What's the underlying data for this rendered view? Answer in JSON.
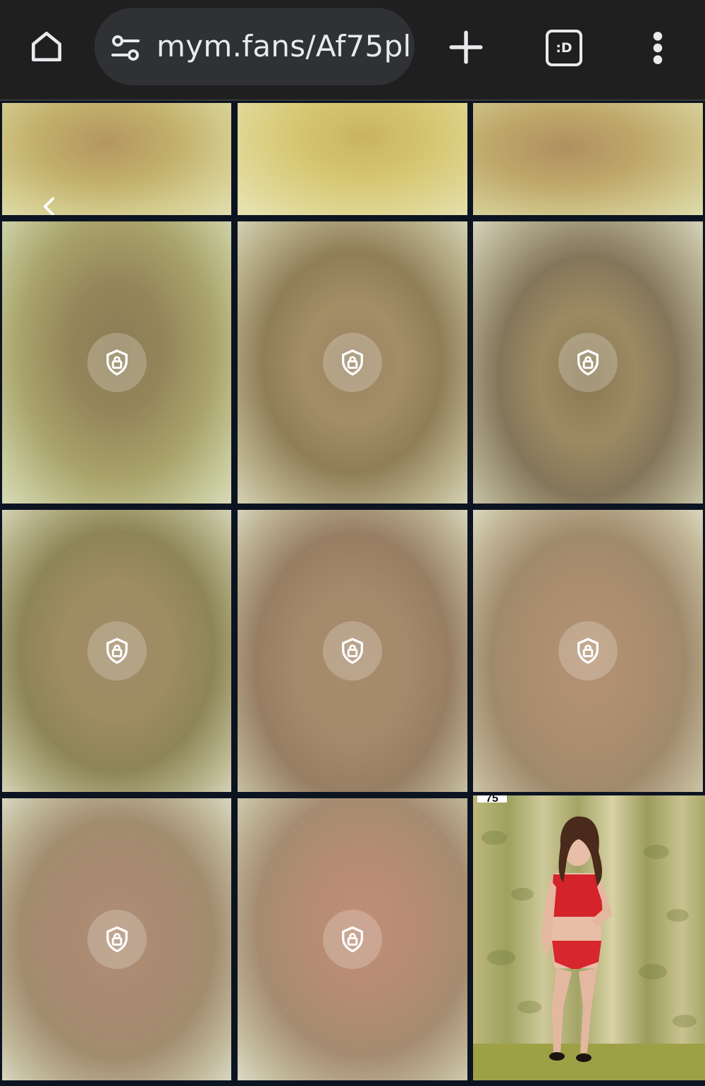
{
  "browser": {
    "url": "mym.fans/Af75pl",
    "tab_count": ":D"
  },
  "gallery": {
    "preview_badge": "75",
    "locked_icon": "shield-lock-icon",
    "tiles_rows": 4,
    "tiles_per_row": 3
  }
}
